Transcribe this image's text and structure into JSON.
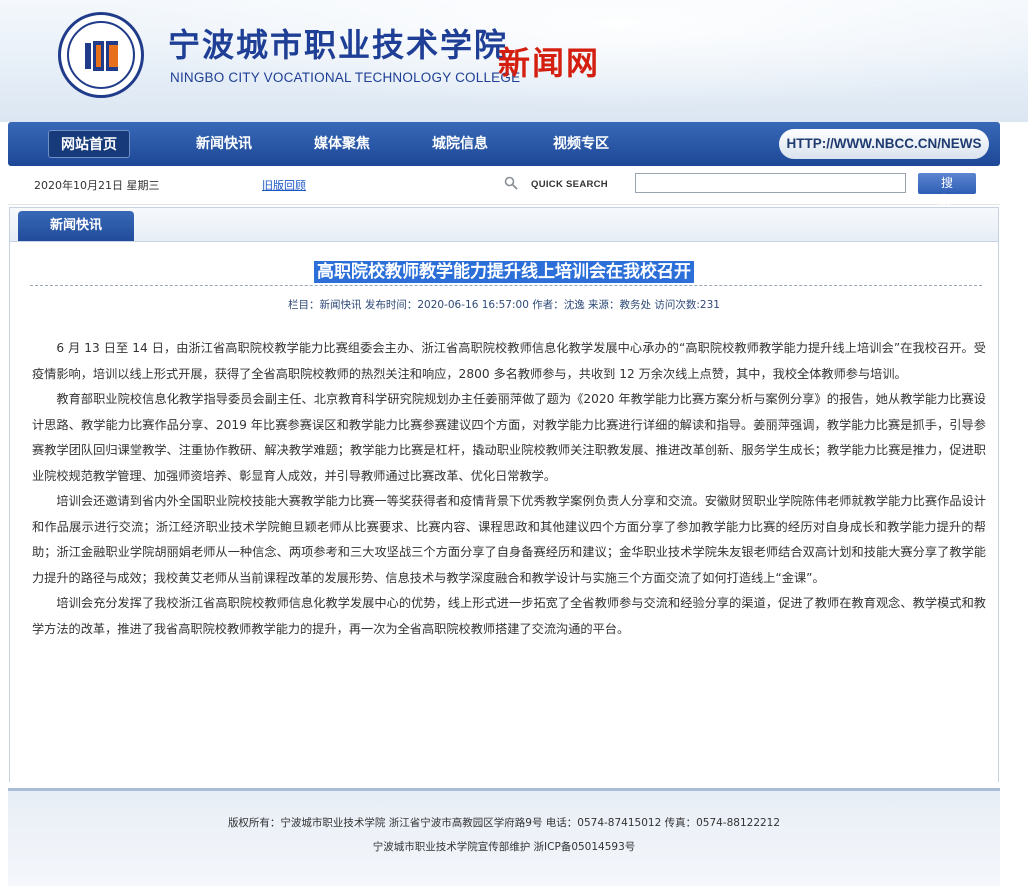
{
  "header": {
    "cn_name": "宁波城市职业技术学院",
    "en_name": "NINGBO CITY VOCATIONAL TECHNOLOGY COLLEGE",
    "site_name": "新闻网",
    "url": "HTTP://WWW.NBCC.CN/NEWS"
  },
  "nav": {
    "items": [
      {
        "label": "网站首页"
      },
      {
        "label": "新闻快讯"
      },
      {
        "label": "媒体聚焦"
      },
      {
        "label": "城院信息"
      },
      {
        "label": "视频专区"
      }
    ]
  },
  "toolbar": {
    "date": "2020年10月21日  星期三",
    "old_link": "旧版回顾",
    "quick_search": "QUICK SEARCH",
    "search_value": "",
    "search_button": "搜 索"
  },
  "panel": {
    "tab": "新闻快讯"
  },
  "article": {
    "title": "高职院校教师教学能力提升线上培训会在我校召开",
    "meta": "栏目：新闻快讯   发布时间：2020-06-16 16:57:00    作者：沈逸  来源：教务处   访问次数:231",
    "paragraphs": [
      "6 月 13 日至 14 日，由浙江省高职院校教学能力比赛组委会主办、浙江省高职院校教师信息化教学发展中心承办的“高职院校教师教学能力提升线上培训会”在我校召开。受疫情影响，培训以线上形式开展，获得了全省高职院校教师的热烈关注和响应，2800 多名教师参与，共收到 12 万余次线上点赞，其中，我校全体教师参与培训。",
      "教育部职业院校信息化教学指导委员会副主任、北京教育科学研究院规划办主任姜丽萍做了题为《2020 年教学能力比赛方案分析与案例分享》的报告，她从教学能力比赛设计思路、教学能力比赛作品分享、2019 年比赛参赛误区和教学能力比赛参赛建议四个方面，对教学能力比赛进行详细的解读和指导。姜丽萍强调，教学能力比赛是抓手，引导参赛教学团队回归课堂教学、注重协作教研、解决教学难题；教学能力比赛是杠杆，撬动职业院校教师关注职教发展、推进改革创新、服务学生成长；教学能力比赛是推力，促进职业院校规范教学管理、加强师资培养、彰显育人成效，并引导教师通过比赛改革、优化日常教学。",
      "培训会还邀请到省内外全国职业院校技能大赛教学能力比赛一等奖获得者和疫情背景下优秀教学案例负责人分享和交流。安徽财贸职业学院陈伟老师就教学能力比赛作品设计和作品展示进行交流；浙江经济职业技术学院鲍旦颖老师从比赛要求、比赛内容、课程思政和其他建议四个方面分享了参加教学能力比赛的经历对自身成长和教学能力提升的帮助；浙江金融职业学院胡丽娟老师从一种信念、两项参考和三大攻坚战三个方面分享了自身备赛经历和建议；金华职业技术学院朱友银老师结合双高计划和技能大赛分享了教学能力提升的路径与成效；我校黄艾老师从当前课程改革的发展形势、信息技术与教学深度融合和教学设计与实施三个方面交流了如何打造线上“金课”。",
      "培训会充分发挥了我校浙江省高职院校教师信息化教学发展中心的优势，线上形式进一步拓宽了全省教师参与交流和经验分享的渠道，促进了教师在教育观念、教学模式和教学方法的改革，推进了我省高职院校教师教学能力的提升，再一次为全省高职院校教师搭建了交流沟通的平台。"
    ]
  },
  "footer": {
    "line1": "版权所有：宁波城市职业技术学院  浙江省宁波市高教园区学府路9号  电话：0574-87415012  传真：0574-88122212",
    "line2": "宁波城市职业技术学院宣传部维护  浙ICP备05014593号"
  },
  "colors": {
    "brand_blue": "#1e3f95",
    "nav_blue": "#2a58a8",
    "site_red": "#d41f10",
    "title_highlight": "#2d6fd8"
  }
}
